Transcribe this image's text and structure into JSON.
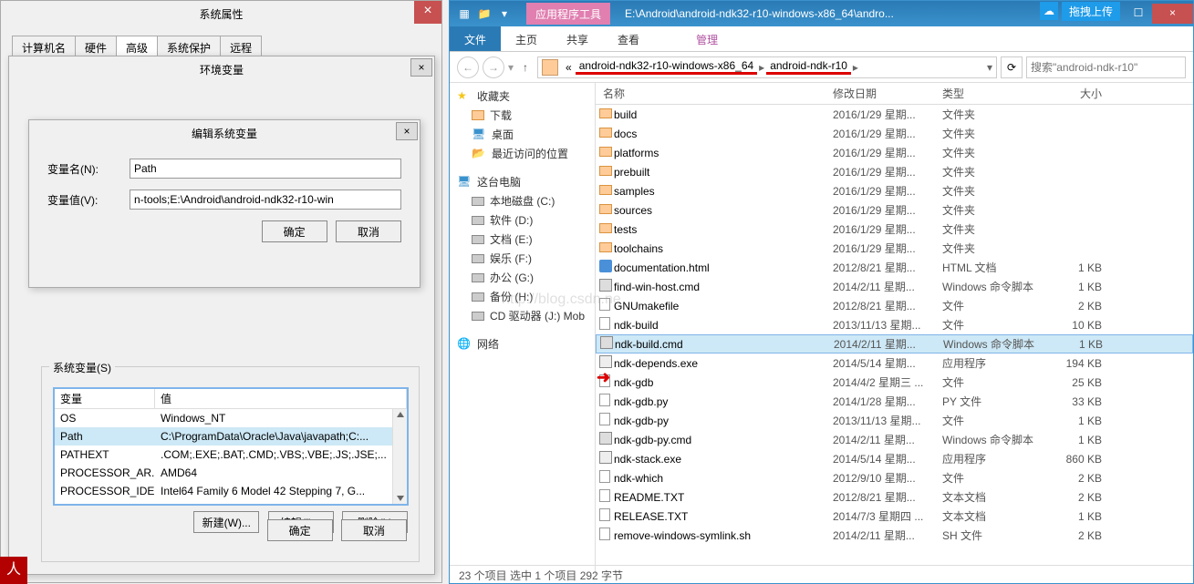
{
  "sysprops": {
    "title": "系统属性",
    "tabs": [
      "计算机名",
      "硬件",
      "高级",
      "系统保护",
      "远程"
    ],
    "activeTab": 2
  },
  "envdialog": {
    "title": "环境变量",
    "sysvar_label": "系统变量(S)",
    "col_var": "变量",
    "col_val": "值",
    "rows": [
      {
        "var": "OS",
        "val": "Windows_NT"
      },
      {
        "var": "Path",
        "val": "C:\\ProgramData\\Oracle\\Java\\javapath;C:..."
      },
      {
        "var": "PATHEXT",
        "val": ".COM;.EXE;.BAT;.CMD;.VBS;.VBE;.JS;.JSE;..."
      },
      {
        "var": "PROCESSOR_AR...",
        "val": "AMD64"
      },
      {
        "var": "PROCESSOR_IDE...",
        "val": "Intel64 Family 6 Model 42 Stepping 7, G..."
      }
    ],
    "btn_new": "新建(W)...",
    "btn_edit": "编辑(I)...",
    "btn_delete": "删除(L)",
    "btn_ok": "确定",
    "btn_cancel": "取消"
  },
  "editdialog": {
    "title": "编辑系统变量",
    "name_label": "变量名(N):",
    "name_value": "Path",
    "value_label": "变量值(V):",
    "value_value": "n-tools;E:\\Android\\android-ndk32-r10-win",
    "btn_ok": "确定",
    "btn_cancel": "取消"
  },
  "explorer": {
    "ribbon_context": "应用程序工具",
    "title_path": "E:\\Android\\android-ndk32-r10-windows-x86_64\\andro...",
    "drag_upload": "拖拽上传",
    "ribbon_tabs": {
      "file": "文件",
      "home": "主页",
      "share": "共享",
      "view": "查看",
      "manage": "管理"
    },
    "breadcrumb": [
      "android-ndk32-r10-windows-x86_64",
      "android-ndk-r10"
    ],
    "bc_prefix": "«",
    "search_placeholder": "搜索\"android-ndk-r10\"",
    "sidebar": {
      "favorites": "收藏夹",
      "downloads": "下载",
      "desktop": "桌面",
      "recent": "最近访问的位置",
      "thispc": "这台电脑",
      "drives": [
        "本地磁盘 (C:)",
        "软件 (D:)",
        "文档 (E:)",
        "娱乐 (F:)",
        "办公 (G:)",
        "备份 (H:)",
        "CD 驱动器 (J:) Mob"
      ],
      "network": "网络"
    },
    "columns": {
      "name": "名称",
      "date": "修改日期",
      "type": "类型",
      "size": "大小"
    },
    "files": [
      {
        "icon": "folder",
        "name": "build",
        "date": "2016/1/29 星期...",
        "type": "文件夹",
        "size": ""
      },
      {
        "icon": "folder",
        "name": "docs",
        "date": "2016/1/29 星期...",
        "type": "文件夹",
        "size": ""
      },
      {
        "icon": "folder",
        "name": "platforms",
        "date": "2016/1/29 星期...",
        "type": "文件夹",
        "size": ""
      },
      {
        "icon": "folder",
        "name": "prebuilt",
        "date": "2016/1/29 星期...",
        "type": "文件夹",
        "size": ""
      },
      {
        "icon": "folder",
        "name": "samples",
        "date": "2016/1/29 星期...",
        "type": "文件夹",
        "size": ""
      },
      {
        "icon": "folder",
        "name": "sources",
        "date": "2016/1/29 星期...",
        "type": "文件夹",
        "size": ""
      },
      {
        "icon": "folder",
        "name": "tests",
        "date": "2016/1/29 星期...",
        "type": "文件夹",
        "size": ""
      },
      {
        "icon": "folder",
        "name": "toolchains",
        "date": "2016/1/29 星期...",
        "type": "文件夹",
        "size": ""
      },
      {
        "icon": "html",
        "name": "documentation.html",
        "date": "2012/8/21 星期...",
        "type": "HTML 文档",
        "size": "1 KB"
      },
      {
        "icon": "cmd",
        "name": "find-win-host.cmd",
        "date": "2014/2/11 星期...",
        "type": "Windows 命令脚本",
        "size": "1 KB"
      },
      {
        "icon": "file",
        "name": "GNUmakefile",
        "date": "2012/8/21 星期...",
        "type": "文件",
        "size": "2 KB"
      },
      {
        "icon": "file",
        "name": "ndk-build",
        "date": "2013/11/13 星期...",
        "type": "文件",
        "size": "10 KB"
      },
      {
        "icon": "cmd",
        "name": "ndk-build.cmd",
        "date": "2014/2/11 星期...",
        "type": "Windows 命令脚本",
        "size": "1 KB",
        "selected": true
      },
      {
        "icon": "exe",
        "name": "ndk-depends.exe",
        "date": "2014/5/14 星期...",
        "type": "应用程序",
        "size": "194 KB"
      },
      {
        "icon": "file",
        "name": "ndk-gdb",
        "date": "2014/4/2 星期三 ...",
        "type": "文件",
        "size": "25 KB"
      },
      {
        "icon": "file",
        "name": "ndk-gdb.py",
        "date": "2014/1/28 星期...",
        "type": "PY 文件",
        "size": "33 KB"
      },
      {
        "icon": "file",
        "name": "ndk-gdb-py",
        "date": "2013/11/13 星期...",
        "type": "文件",
        "size": "1 KB"
      },
      {
        "icon": "cmd",
        "name": "ndk-gdb-py.cmd",
        "date": "2014/2/11 星期...",
        "type": "Windows 命令脚本",
        "size": "1 KB"
      },
      {
        "icon": "exe",
        "name": "ndk-stack.exe",
        "date": "2014/5/14 星期...",
        "type": "应用程序",
        "size": "860 KB"
      },
      {
        "icon": "file",
        "name": "ndk-which",
        "date": "2012/9/10 星期...",
        "type": "文件",
        "size": "2 KB"
      },
      {
        "icon": "file",
        "name": "README.TXT",
        "date": "2012/8/21 星期...",
        "type": "文本文档",
        "size": "2 KB"
      },
      {
        "icon": "file",
        "name": "RELEASE.TXT",
        "date": "2014/7/3 星期四 ...",
        "type": "文本文档",
        "size": "1 KB"
      },
      {
        "icon": "file",
        "name": "remove-windows-symlink.sh",
        "date": "2014/2/11 星期...",
        "type": "SH 文件",
        "size": "2 KB"
      }
    ],
    "status": "23 个项目    选中 1 个项目  292 字节"
  },
  "watermark": "http://blog.csdn.ne"
}
